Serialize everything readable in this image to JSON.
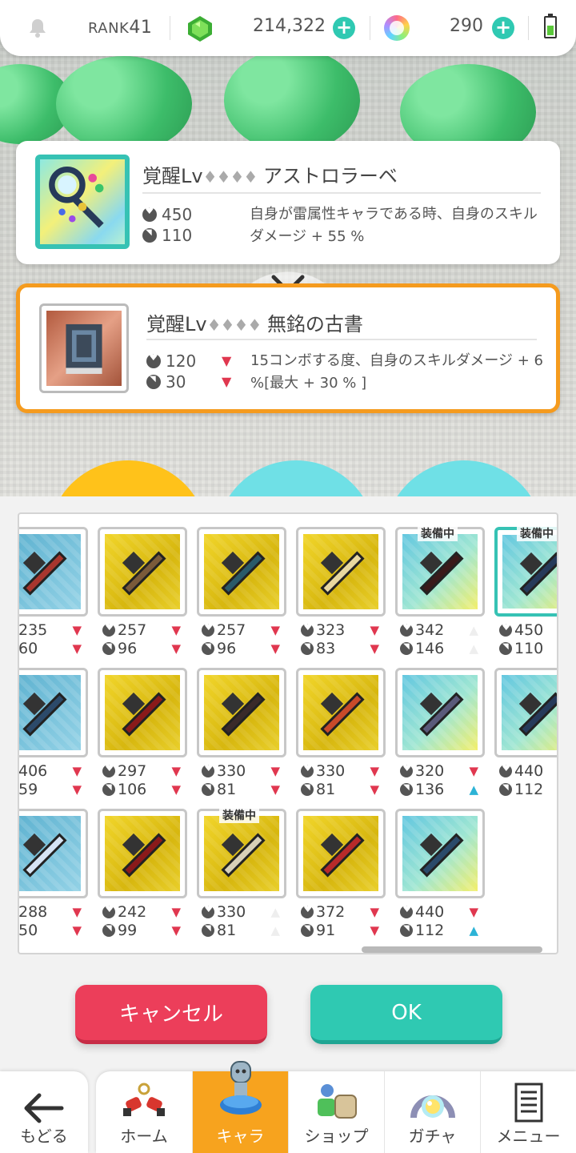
{
  "status_bar": {
    "rank_label": "RANK",
    "rank_value": "41",
    "gems": "214,322",
    "orbs": "290"
  },
  "current_equipment": {
    "title_prefix": "覚醒Lv",
    "awakening_diamonds": "♦♦♦♦",
    "name": "アストロラーベ",
    "hp": "450",
    "speed": "110",
    "description": "自身が雷属性キャラである時、自身のスキルダメージ + 55 %"
  },
  "candidate_equipment": {
    "title_prefix": "覚醒Lv",
    "awakening_diamonds": "♦♦♦♦",
    "name": "無銘の古書",
    "hp": "120",
    "speed": "30",
    "hp_trend": "down",
    "speed_trend": "down",
    "description": "15コンボする度、自身のスキルダメージ + 6 %[最大 + 30 % ]"
  },
  "inventory": {
    "equipped_label": "装備中",
    "items": [
      {
        "hp": "235",
        "speed": "60",
        "hp_arrow": "down",
        "speed_arrow": "down",
        "bg": "blue",
        "equipped": false,
        "selected": false
      },
      {
        "hp": "257",
        "speed": "96",
        "hp_arrow": "down",
        "speed_arrow": "down",
        "bg": "gold",
        "equipped": false,
        "selected": false
      },
      {
        "hp": "257",
        "speed": "96",
        "hp_arrow": "down",
        "speed_arrow": "down",
        "bg": "gold",
        "equipped": false,
        "selected": false
      },
      {
        "hp": "323",
        "speed": "83",
        "hp_arrow": "down",
        "speed_arrow": "down",
        "bg": "gold",
        "equipped": false,
        "selected": false
      },
      {
        "hp": "342",
        "speed": "146",
        "hp_arrow": "none",
        "speed_arrow": "none",
        "bg": "aqua",
        "equipped": true,
        "selected": false
      },
      {
        "hp": "450",
        "speed": "110",
        "hp_arrow": "",
        "speed_arrow": "",
        "bg": "aqua",
        "equipped": true,
        "selected": true
      },
      {
        "hp": "406",
        "speed": "59",
        "hp_arrow": "down",
        "speed_arrow": "down",
        "bg": "blue",
        "equipped": false,
        "selected": false
      },
      {
        "hp": "297",
        "speed": "106",
        "hp_arrow": "down",
        "speed_arrow": "down",
        "bg": "gold",
        "equipped": false,
        "selected": false
      },
      {
        "hp": "330",
        "speed": "81",
        "hp_arrow": "down",
        "speed_arrow": "down",
        "bg": "gold",
        "equipped": false,
        "selected": false
      },
      {
        "hp": "330",
        "speed": "81",
        "hp_arrow": "down",
        "speed_arrow": "down",
        "bg": "gold",
        "equipped": false,
        "selected": false
      },
      {
        "hp": "320",
        "speed": "136",
        "hp_arrow": "down",
        "speed_arrow": "up",
        "bg": "aqua",
        "equipped": false,
        "selected": false
      },
      {
        "hp": "440",
        "speed": "112",
        "hp_arrow": "",
        "speed_arrow": "",
        "bg": "aqua",
        "equipped": false,
        "selected": false
      },
      {
        "hp": "288",
        "speed": "50",
        "hp_arrow": "down",
        "speed_arrow": "down",
        "bg": "blue",
        "equipped": false,
        "selected": false
      },
      {
        "hp": "242",
        "speed": "99",
        "hp_arrow": "down",
        "speed_arrow": "down",
        "bg": "gold",
        "equipped": false,
        "selected": false
      },
      {
        "hp": "330",
        "speed": "81",
        "hp_arrow": "none",
        "speed_arrow": "none",
        "bg": "gold",
        "equipped": true,
        "selected": false
      },
      {
        "hp": "372",
        "speed": "91",
        "hp_arrow": "down",
        "speed_arrow": "down",
        "bg": "gold",
        "equipped": false,
        "selected": false
      },
      {
        "hp": "440",
        "speed": "112",
        "hp_arrow": "down",
        "speed_arrow": "up",
        "bg": "aqua",
        "equipped": false,
        "selected": false
      }
    ]
  },
  "buttons": {
    "cancel": "キャンセル",
    "ok": "OK"
  },
  "nav": {
    "back": "もどる",
    "home": "ホーム",
    "chara": "キャラ",
    "shop": "ショップ",
    "gacha": "ガチャ",
    "menu": "メニュー"
  },
  "colors": {
    "accent_teal": "#2fc9b2",
    "cancel_red": "#ec3e5a",
    "candidate_orange": "#f59b1e",
    "down_arrow": "#e0374f",
    "up_arrow": "#2cb3d6"
  }
}
